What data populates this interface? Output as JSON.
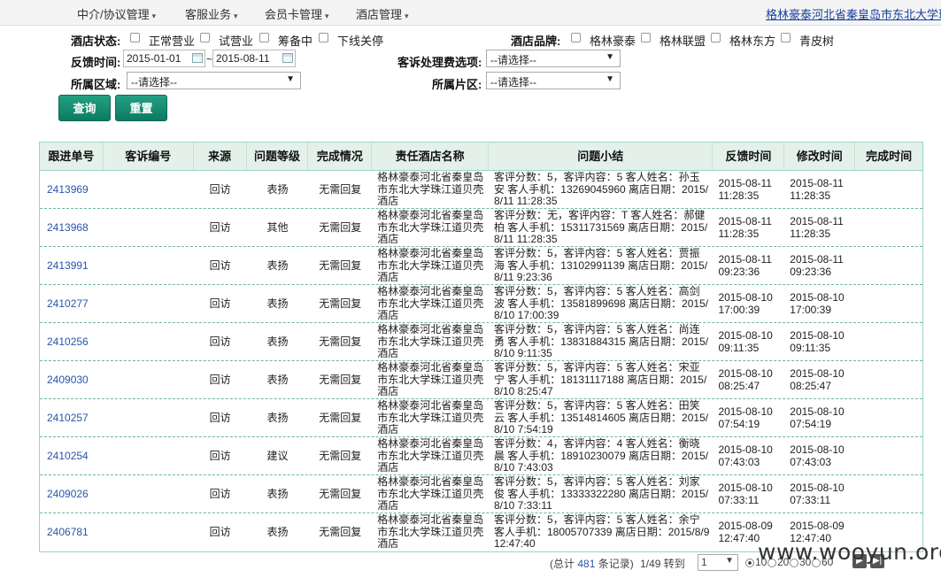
{
  "nav": {
    "menus": [
      "中介/协议管理",
      "客服业务",
      "会员卡管理",
      "酒店管理"
    ],
    "hotel_link": "格林豪泰河北省秦皇岛市东北大学珠江"
  },
  "filters": {
    "status_label": "酒店状态:",
    "status_options": [
      "正常营业",
      "试营业",
      "筹备中",
      "下线关停"
    ],
    "brand_label": "酒店品牌:",
    "brand_options": [
      "格林豪泰",
      "格林联盟",
      "格林东方",
      "青皮树"
    ],
    "feedback_time_label": "反馈时间:",
    "date_from": "2015-01-01",
    "date_to": "2015-08-11",
    "tilde": "~",
    "fee_label": "客诉处理费选项:",
    "fee_value": "--请选择--",
    "region_label": "所属区域:",
    "region_value": "--请选择--",
    "area_label": "所属片区:",
    "area_value": "--请选择--",
    "query_button": "查询",
    "reset_button": "重置"
  },
  "table": {
    "headers": [
      "跟进单号",
      "客诉编号",
      "来源",
      "问题等级",
      "完成情况",
      "责任酒店名称",
      "问题小结",
      "反馈时间",
      "修改时间",
      "完成时间"
    ],
    "rows": [
      {
        "id": "2413969",
        "complaint_no": "",
        "source": "回访",
        "level": "表扬",
        "status": "无需回复",
        "hotel": "格林豪泰河北省秦皇岛市东北大学珠江道贝壳酒店",
        "summary": "客评分数：5，客评内容：5 客人姓名：孙玉安 客人手机：13269045960 离店日期：2015/8/11 11:28:35",
        "feedback_date": "2015-08-11",
        "feedback_time": "11:28:35",
        "modify_date": "2015-08-11",
        "modify_time": "11:28:35",
        "done": ""
      },
      {
        "id": "2413968",
        "complaint_no": "",
        "source": "回访",
        "level": "其他",
        "status": "无需回复",
        "hotel": "格林豪泰河北省秦皇岛市东北大学珠江道贝壳酒店",
        "summary": "客评分数：无，客评内容：T 客人姓名：郝健柏 客人手机：15311731569 离店日期：2015/8/11 11:28:35",
        "feedback_date": "2015-08-11",
        "feedback_time": "11:28:35",
        "modify_date": "2015-08-11",
        "modify_time": "11:28:35",
        "done": ""
      },
      {
        "id": "2413991",
        "complaint_no": "",
        "source": "回访",
        "level": "表扬",
        "status": "无需回复",
        "hotel": "格林豪泰河北省秦皇岛市东北大学珠江道贝壳酒店",
        "summary": "客评分数：5，客评内容：5 客人姓名：贾振海 客人手机：13102991139 离店日期：2015/8/11 9:23:36",
        "feedback_date": "2015-08-11",
        "feedback_time": "09:23:36",
        "modify_date": "2015-08-11",
        "modify_time": "09:23:36",
        "done": ""
      },
      {
        "id": "2410277",
        "complaint_no": "",
        "source": "回访",
        "level": "表扬",
        "status": "无需回复",
        "hotel": "格林豪泰河北省秦皇岛市东北大学珠江道贝壳酒店",
        "summary": "客评分数：5，客评内容：5 客人姓名：高剑波 客人手机：13581899698 离店日期：2015/8/10 17:00:39",
        "feedback_date": "2015-08-10",
        "feedback_time": "17:00:39",
        "modify_date": "2015-08-10",
        "modify_time": "17:00:39",
        "done": ""
      },
      {
        "id": "2410256",
        "complaint_no": "",
        "source": "回访",
        "level": "表扬",
        "status": "无需回复",
        "hotel": "格林豪泰河北省秦皇岛市东北大学珠江道贝壳酒店",
        "summary": "客评分数：5，客评内容：5 客人姓名：尚连勇 客人手机：13831884315 离店日期：2015/8/10 9:11:35",
        "feedback_date": "2015-08-10",
        "feedback_time": "09:11:35",
        "modify_date": "2015-08-10",
        "modify_time": "09:11:35",
        "done": ""
      },
      {
        "id": "2409030",
        "complaint_no": "",
        "source": "回访",
        "level": "表扬",
        "status": "无需回复",
        "hotel": "格林豪泰河北省秦皇岛市东北大学珠江道贝壳酒店",
        "summary": "客评分数：5，客评内容：5 客人姓名：宋亚宁 客人手机：18131117188 离店日期：2015/8/10 8:25:47",
        "feedback_date": "2015-08-10",
        "feedback_time": "08:25:47",
        "modify_date": "2015-08-10",
        "modify_time": "08:25:47",
        "done": ""
      },
      {
        "id": "2410257",
        "complaint_no": "",
        "source": "回访",
        "level": "表扬",
        "status": "无需回复",
        "hotel": "格林豪泰河北省秦皇岛市东北大学珠江道贝壳酒店",
        "summary": "客评分数：5，客评内容：5 客人姓名：田笑云 客人手机：13514814605 离店日期：2015/8/10 7:54:19",
        "feedback_date": "2015-08-10",
        "feedback_time": "07:54:19",
        "modify_date": "2015-08-10",
        "modify_time": "07:54:19",
        "done": ""
      },
      {
        "id": "2410254",
        "complaint_no": "",
        "source": "回访",
        "level": "建议",
        "status": "无需回复",
        "hotel": "格林豪泰河北省秦皇岛市东北大学珠江道贝壳酒店",
        "summary": "客评分数：4，客评内容：4 客人姓名：衡晓晨 客人手机：18910230079 离店日期：2015/8/10 7:43:03",
        "feedback_date": "2015-08-10",
        "feedback_time": "07:43:03",
        "modify_date": "2015-08-10",
        "modify_time": "07:43:03",
        "done": ""
      },
      {
        "id": "2409026",
        "complaint_no": "",
        "source": "回访",
        "level": "表扬",
        "status": "无需回复",
        "hotel": "格林豪泰河北省秦皇岛市东北大学珠江道贝壳酒店",
        "summary": "客评分数：5，客评内容：5 客人姓名：刘家俊 客人手机：13333322280 离店日期：2015/8/10 7:33:11",
        "feedback_date": "2015-08-10",
        "feedback_time": "07:33:11",
        "modify_date": "2015-08-10",
        "modify_time": "07:33:11",
        "done": ""
      },
      {
        "id": "2406781",
        "complaint_no": "",
        "source": "回访",
        "level": "表扬",
        "status": "无需回复",
        "hotel": "格林豪泰河北省秦皇岛市东北大学珠江道贝壳酒店",
        "summary": "客评分数：5，客评内容：5 客人姓名：余宁 客人手机：18005707339 离店日期：2015/8/9 12:47:40",
        "feedback_date": "2015-08-09",
        "feedback_time": "12:47:40",
        "modify_date": "2015-08-09",
        "modify_time": "12:47:40",
        "done": ""
      }
    ]
  },
  "pager": {
    "total_prefix": "(总计",
    "total": "481",
    "total_suffix": "条记录)",
    "page_info": "1/49",
    "goto": "转到",
    "page_select": "1",
    "page_sizes": [
      "10",
      "20",
      "30",
      "60"
    ],
    "selected_size": "10"
  },
  "watermark": "www.wooyun.org"
}
